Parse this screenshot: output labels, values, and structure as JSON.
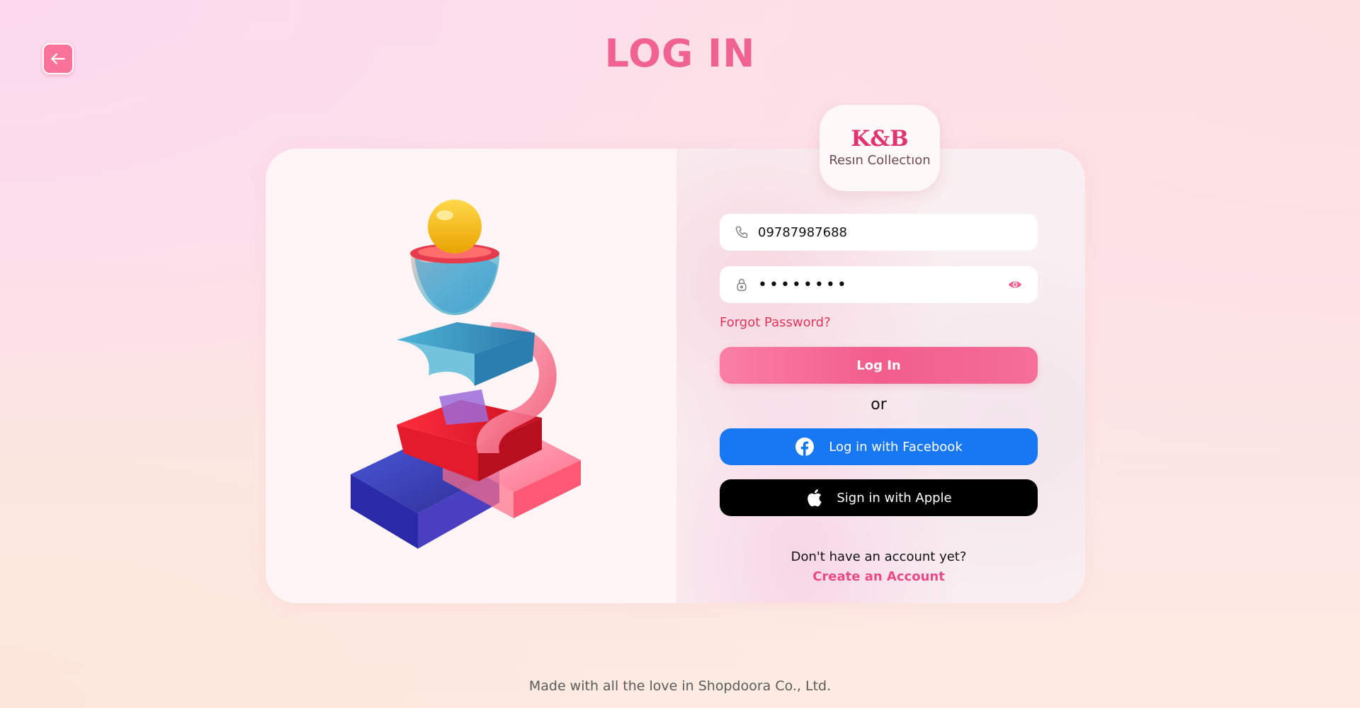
{
  "header": {
    "title": "LOG IN",
    "back_icon": "arrow-left-icon"
  },
  "brand": {
    "name": "K&B",
    "subtitle": "Resın Collectıon"
  },
  "form": {
    "phone": {
      "icon": "phone-icon",
      "value": "09787987688"
    },
    "password": {
      "icon": "lock-icon",
      "value": "••••••••",
      "toggle_icon": "eye-icon"
    },
    "forgot_label": "Forgot Password?",
    "login_label": "Log In",
    "separator": "or",
    "facebook_label": "Log in with Facebook",
    "facebook_icon": "facebook-icon",
    "apple_label": "Sign in with Apple",
    "apple_icon": "apple-icon",
    "signup_prompt": "Don't have an account yet?",
    "signup_link": "Create an Account"
  },
  "footer": {
    "text": "Made with all the love in Shopdoora Co., Ltd."
  },
  "colors": {
    "accent": "#f06292",
    "facebook": "#1877f2",
    "apple": "#000000",
    "link": "#e0335a"
  }
}
